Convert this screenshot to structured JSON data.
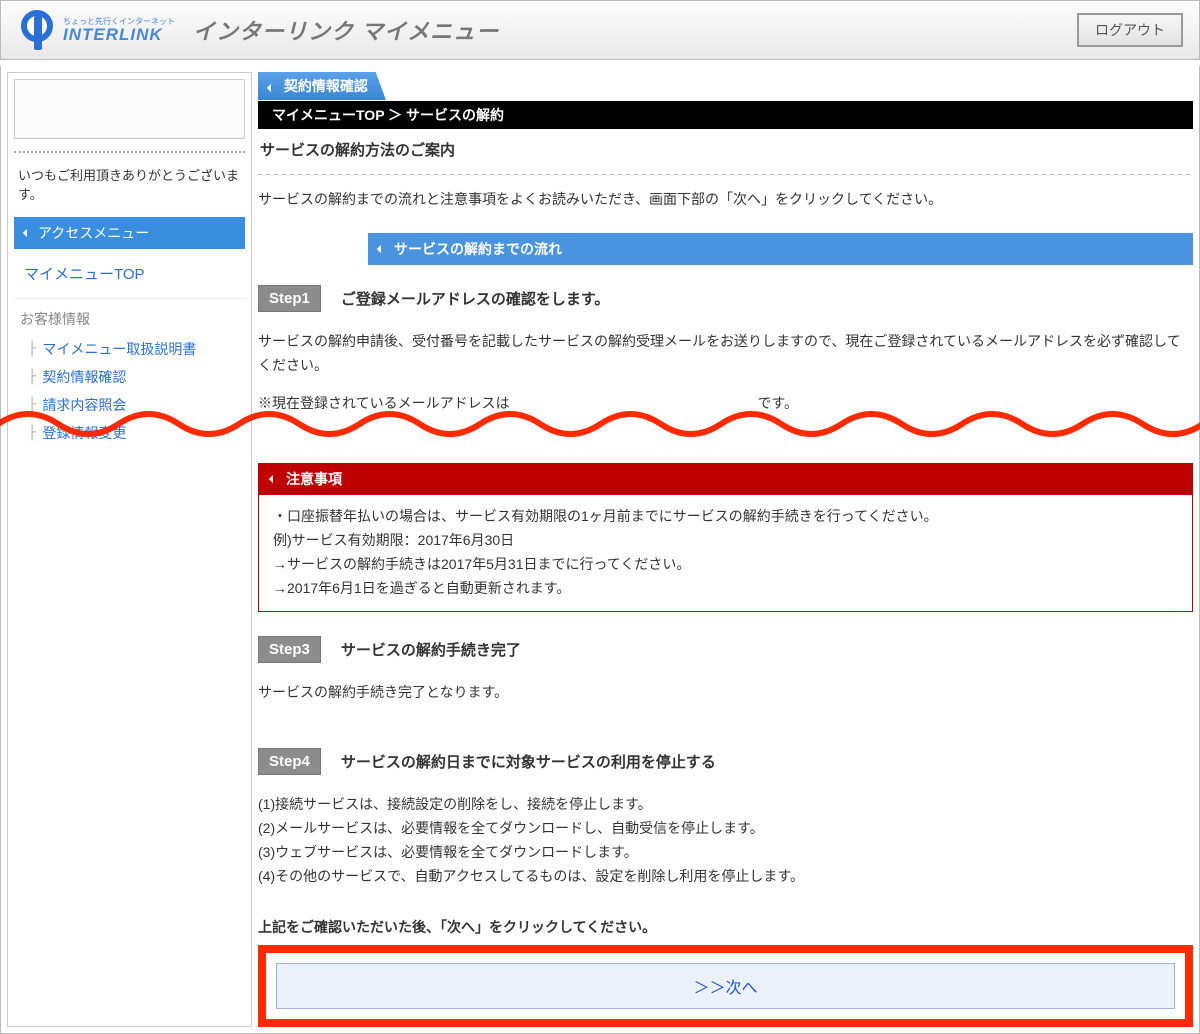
{
  "header": {
    "logo_tagline": "ちょっと先行くインターネット",
    "logo_brand": "INTERLINK",
    "title": "インターリンク マイメニュー",
    "logout_label": "ログアウト"
  },
  "sidebar": {
    "thanks_text": "いつもご利用頂きありがとうございます。",
    "access_menu_label": "アクセスメニュー",
    "top_link": "マイメニューTOP",
    "group_label": "お客様情報",
    "items": [
      {
        "label": "マイメニュー取扱説明書"
      },
      {
        "label": "契約情報確認"
      },
      {
        "label": "請求内容照会"
      },
      {
        "label": "登録情報変更"
      }
    ]
  },
  "main": {
    "tab_label": "契約情報確認",
    "breadcrumb": "マイメニューTOP ＞ サービスの解約",
    "page_title": "サービスの解約方法のご案内",
    "lead": "サービスの解約までの流れと注意事項をよくお読みいただき、画面下部の「次へ」をクリックしてください。",
    "flow_section_label": "サービスの解約までの流れ",
    "step1_badge": "Step1",
    "step1_title": "ご登録メールアドレスの確認をします。",
    "step1_para": "サービスの解約申請後、受付番号を記載したサービスの解約受理メールをお送りしますので、現在ご登録されているメールアドレスを必ず確認してください。",
    "step1_note_prefix": "※現在登録されているメールアドレスは",
    "step1_note_suffix": "です。",
    "warning_header": "注意事項",
    "warning_lines": [
      "・口座振替年払いの場合は、サービス有効期限の1ヶ月前までにサービスの解約手続きを行ってください。",
      "例)サービス有効期限：2017年6月30日",
      "→サービスの解約手続きは2017年5月31日までに行ってください。",
      "→2017年6月1日を過ぎると自動更新されます。"
    ],
    "step3_badge": "Step3",
    "step3_title": "サービスの解約手続き完了",
    "step3_para": "サービスの解約手続き完了となります。",
    "step4_badge": "Step4",
    "step4_title": "サービスの解約日までに対象サービスの利用を停止する",
    "step4_lines": [
      "(1)接続サービスは、接続設定の削除をし、接続を停止します。",
      "(2)メールサービスは、必要情報を全てダウンロードし、自動受信を停止します。",
      "(3)ウェブサービスは、必要情報を全てダウンロードします。",
      "(4)その他のサービスで、自動アクセスしてるものは、設定を削除し利用を停止します。"
    ],
    "confirm_text": "上記をご確認いただいた後、「次へ」をクリックしてください。",
    "next_label": "＞＞次へ"
  }
}
